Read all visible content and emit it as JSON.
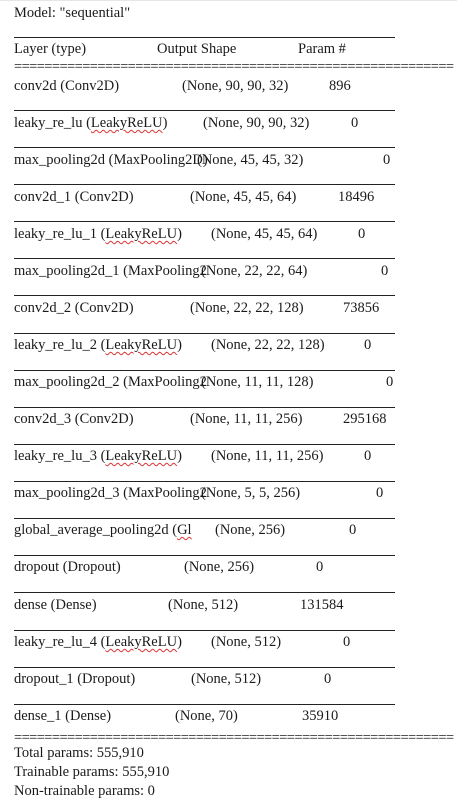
{
  "model_title": "Model: \"sequential\"",
  "header": {
    "layer": "Layer (type)",
    "output": "Output Shape",
    "params": "Param #"
  },
  "rule_top": "==========================================================",
  "rule_bottom": "==========================================================",
  "rows": [
    {
      "name": "conv2d (Conv2D)",
      "shape": "(None, 90, 90, 32)",
      "params": "896"
    },
    {
      "pre": "leaky_re_lu (",
      "typ": "LeakyReLU",
      "post": ")",
      "shape": "(None, 90, 90, 32)",
      "params": "0"
    },
    {
      "name": "max_pooling2d (MaxPooling2D)",
      "shape": "(None, 45, 45, 32)",
      "params": "0"
    },
    {
      "name": "conv2d_1 (Conv2D)",
      "shape": "(None, 45, 45, 64)",
      "params": "18496"
    },
    {
      "pre": "leaky_re_lu_1 (",
      "typ": "LeakyReLU",
      "post": ")",
      "shape": "(None, 45, 45, 64)",
      "params": "0"
    },
    {
      "name": "max_pooling2d_1 (MaxPooling2",
      "shape": "(None, 22, 22, 64)",
      "params": "0"
    },
    {
      "name": "conv2d_2 (Conv2D)",
      "shape": "(None, 22, 22, 128)",
      "params": "73856"
    },
    {
      "pre": "leaky_re_lu_2 (",
      "typ": "LeakyReLU",
      "post": ")",
      "shape": "(None, 22, 22, 128)",
      "params": "0"
    },
    {
      "name": "max_pooling2d_2 (MaxPooling2",
      "shape": "(None, 11, 11, 128)",
      "params": "0"
    },
    {
      "name": "conv2d_3 (Conv2D)",
      "shape": "(None, 11, 11, 256)",
      "params": "295168"
    },
    {
      "pre": "leaky_re_lu_3 (",
      "typ": "LeakyReLU",
      "post": ")",
      "shape": "(None, 11, 11, 256)",
      "params": "0"
    },
    {
      "name": "max_pooling2d_3 (MaxPooling2",
      "shape": "(None, 5, 5, 256)",
      "params": "0"
    },
    {
      "pre": "global_average_pooling2d (",
      "typ": "Gl",
      "post": "",
      "shape": "(None, 256)",
      "params": "0"
    },
    {
      "name": "dropout (Dropout)",
      "shape": "(None, 256)",
      "params": "0"
    },
    {
      "name": "dense (Dense)",
      "shape": "(None, 512)",
      "params": "131584"
    },
    {
      "pre": "leaky_re_lu_4 (",
      "typ": "LeakyReLU",
      "post": ")",
      "shape": "(None, 512)",
      "params": "0"
    },
    {
      "name": "dropout_1 (Dropout)",
      "shape": "(None, 512)",
      "params": "0"
    },
    {
      "name": "dense_1 (Dense)",
      "shape": "(None, 70)",
      "params": "35910"
    }
  ],
  "totals": {
    "total": "Total params: 555,910",
    "trainable": "Trainable params: 555,910",
    "non_trainable": "Non-trainable params: 0"
  }
}
